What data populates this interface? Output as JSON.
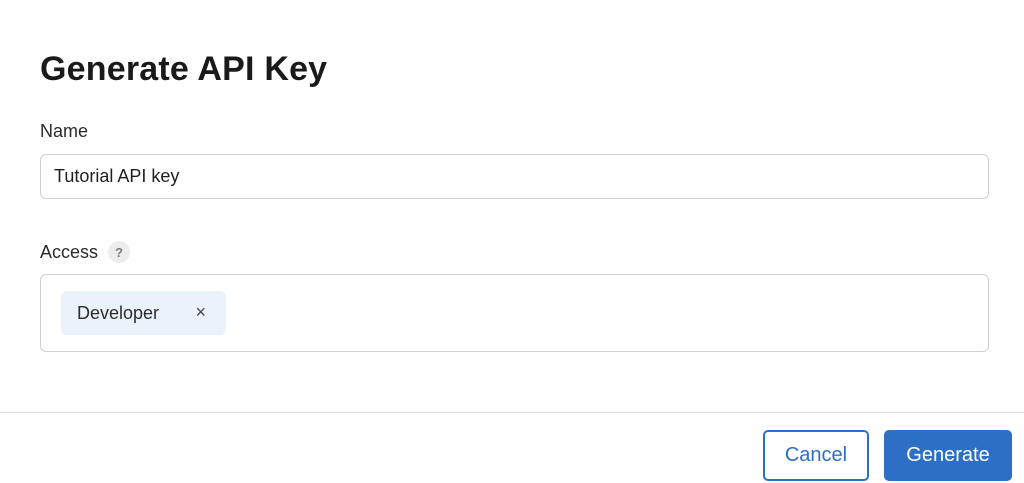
{
  "dialog": {
    "title": "Generate API Key"
  },
  "name_field": {
    "label": "Name",
    "value": "Tutorial API key"
  },
  "access_field": {
    "label": "Access",
    "help_icon": "question-mark-icon",
    "help_glyph": "?",
    "tags": [
      {
        "label": "Developer",
        "remove_glyph": "×"
      }
    ]
  },
  "footer": {
    "cancel_label": "Cancel",
    "generate_label": "Generate"
  },
  "colors": {
    "accent": "#2d6fc4",
    "tag_background": "#eaf2fb"
  }
}
